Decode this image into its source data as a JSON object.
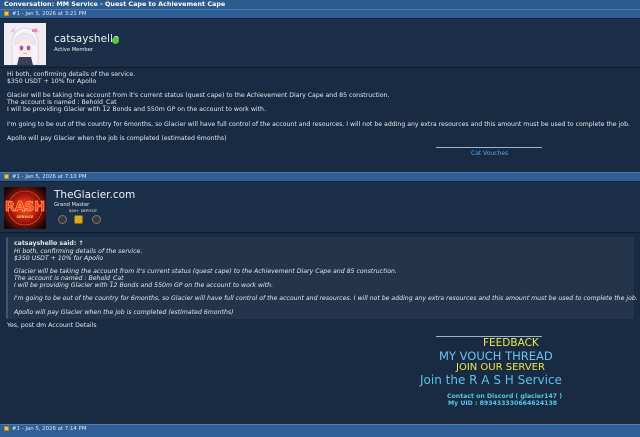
{
  "window": {
    "title": "Conversation: MM Service - Quest Cape to Achievement Cape"
  },
  "posts": [
    {
      "header": "#1 - Jan 5, 2026 at 3:21 PM",
      "username": "catsayshello",
      "rank": "Active Member",
      "lines": [
        "Hi both, confirming details of the service.",
        "$350 USDT + 10% for Apollo",
        "",
        "Glacier will be taking the account from it's current status (quest cape) to the Achievement Diary Cape and 85 construction.",
        "The account is named : Behold_Cat",
        "I will be providing Glacier with 12 Bonds and 550m GP on the account to work with.",
        "",
        "I'm going to be out of the country for 6months, so Glacier will have full control of the account and resources. I will not be adding any extra resources and this amount must be used to complete the job.",
        "",
        "Apollo will pay Glacier when the job is completed (estimated 6months)"
      ],
      "signature": "Cat Vouches"
    },
    {
      "header": "#1 - Jan 5, 2026 at 7:10 PM",
      "username": "TheGlacier.com",
      "rank": "Grand Master",
      "rank_sub": "$50+ DEPOSIT",
      "avatar_text": "RASH",
      "avatar_sub": "SERVICE",
      "quote_author": "catsayshello said: ↑",
      "quote_lines": [
        "Hi both, confirming details of the service.",
        "$350 USDT + 10% for Apollo",
        "",
        "Glacier will be taking the account from it's current status (quest cape) to the Achievement Diary Cape and 85 construction.",
        "The account is named : Behold_Cat",
        "I will be providing Glacier with 12 Bonds and 550m GP on the account to work with.",
        "",
        "I'm going to be out of the country for 6months, so Glacier will have full control of the account and resources. I will not be adding any extra resources and this amount must be used to complete the job.",
        "",
        "Apollo will pay Glacier when the job is completed (estimated 6months)"
      ],
      "reply": "Yes, post dm Account Details",
      "sig": {
        "feedback": "FEEDBACK",
        "vouch": "MY VOUCH THREAD",
        "server": "JOIN OUR SERVER",
        "join": "Join the R A S H Service",
        "discord": "Contact on Discord ( glacier147 )",
        "uid": "My UID : 893433330664624138"
      }
    },
    {
      "header": "#1 - Jan 5, 2026 at 7:14 PM"
    }
  ],
  "colors": {
    "accent": "#2c5a8c",
    "online": "#5fc53a",
    "feedback": "#ece94a",
    "link": "#5fa2e6"
  },
  "icons": [
    "post-icon",
    "online-status-icon",
    "trophy-icon"
  ]
}
